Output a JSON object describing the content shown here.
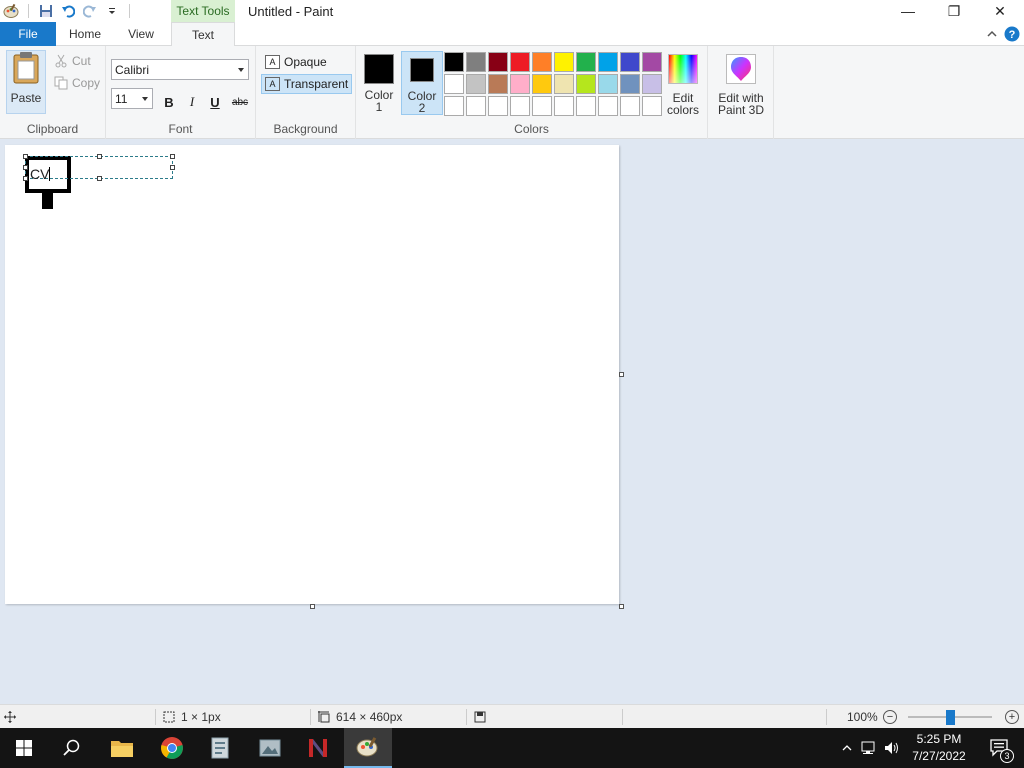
{
  "window": {
    "title": "Untitled - Paint",
    "context_tab": "Text Tools",
    "minimize": "—",
    "restore": "❐",
    "close": "✕"
  },
  "tabs": {
    "file": "File",
    "home": "Home",
    "view": "View",
    "text": "Text"
  },
  "clipboard": {
    "paste": "Paste",
    "cut": "Cut",
    "copy": "Copy",
    "group": "Clipboard"
  },
  "font": {
    "family": "Calibri",
    "size": "11",
    "bold": "B",
    "italic": "I",
    "underline": "U",
    "strikethrough": "abc",
    "group": "Font"
  },
  "background": {
    "opaque": "Opaque",
    "transparent": "Transparent",
    "group": "Background"
  },
  "colors": {
    "color1_line1": "Color",
    "color1_line2": "1",
    "color2_line1": "Color",
    "color2_line2": "2",
    "color1_value": "#000000",
    "color2_value": "#000000",
    "edit_colors_line1": "Edit",
    "edit_colors_line2": "colors",
    "group": "Colors",
    "palette": [
      "#000000",
      "#7f7f7f",
      "#880015",
      "#ed1c24",
      "#ff7f27",
      "#fff200",
      "#22b14c",
      "#00a2e8",
      "#3f48cc",
      "#a349a4",
      "#ffffff",
      "#c3c3c3",
      "#b97a57",
      "#ffaec9",
      "#ffc90e",
      "#efe4b0",
      "#b5e61d",
      "#99d9ea",
      "#7092be",
      "#c8bfe7",
      "#ffffff",
      "#ffffff",
      "#ffffff",
      "#ffffff",
      "#ffffff",
      "#ffffff",
      "#ffffff",
      "#ffffff",
      "#ffffff",
      "#ffffff"
    ]
  },
  "paint3d": {
    "line1": "Edit with",
    "line2": "Paint 3D"
  },
  "canvas": {
    "typed_text": "CV"
  },
  "status": {
    "selection": "1 × 1px",
    "canvas_size": "614 × 460px",
    "zoom": "100%"
  },
  "taskbar": {
    "time": "5:25 PM",
    "date": "7/27/2022",
    "notifications": "3"
  }
}
